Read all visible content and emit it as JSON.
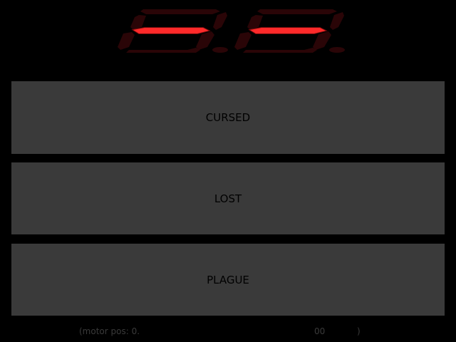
{
  "display": {
    "digit_count": 2,
    "lit_segment": "g",
    "colors": {
      "lit": "#ff2a2a",
      "lit_glow": "#b31212",
      "unlit": "#2a0507",
      "background": "#000000"
    }
  },
  "choices": [
    {
      "label": "CURSED"
    },
    {
      "label": "LOST"
    },
    {
      "label": "PLAGUE"
    }
  ],
  "status": {
    "prefix": "(motor pos: 0.",
    "value": "00",
    "suffix": ")"
  },
  "colors": {
    "button_bg": "#3a3a3a",
    "button_text": "#000000",
    "status_text": "#3a3a3a"
  }
}
